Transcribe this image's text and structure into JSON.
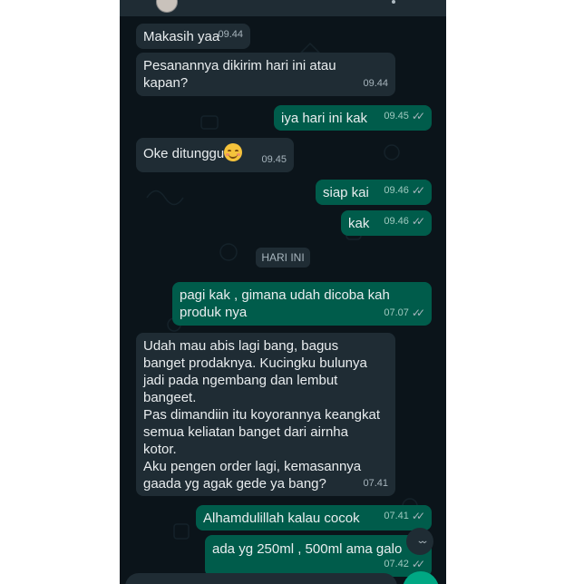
{
  "chat": {
    "messages": [
      {
        "dir": "in",
        "text": "Makasih yaa",
        "time": "09.44"
      },
      {
        "dir": "in",
        "text": "Pesanannya dikirim hari ini atau kapan?",
        "time": "09.44"
      },
      {
        "dir": "out",
        "text": "iya hari ini kak",
        "time": "09.45",
        "status": "read"
      },
      {
        "dir": "in",
        "text": "Oke ditunggu",
        "emoji": "smiling-face-icon",
        "time": "09.45"
      },
      {
        "dir": "out",
        "text": "siap kai",
        "time": "09.46",
        "status": "read"
      },
      {
        "dir": "out",
        "text": "kak",
        "time": "09.46",
        "status": "read"
      },
      {
        "dir": "out",
        "text": "pagi kak , gimana udah dicoba kah produk nya",
        "time": "07.07",
        "status": "read"
      },
      {
        "dir": "in",
        "text": "Udah mau abis lagi bang, bagus banget prodaknya. Kucingku bulunya jadi pada ngembang dan lembut bangeet.\nPas dimandiin itu koyorannya keangkat semua keliatan banget dari airnha kotor.\nAku pengen order lagi, kemasannya gaada yg agak gede ya bang?",
        "time": "07.41"
      },
      {
        "dir": "out",
        "text": "Alhamdulillah kalau cocok",
        "time": "07.41",
        "status": "read"
      },
      {
        "dir": "out",
        "text": "ada yg 250ml , 500ml ama galo",
        "time": "07.42",
        "status": "read"
      }
    ],
    "day_divider": "HARI INI",
    "read_ticks": "✓✓",
    "scroll_down_glyph": "⌄⌄"
  },
  "colors": {
    "chat_background": "#0b141a",
    "incoming_bubble": "#1f2c34",
    "outgoing_bubble": "#005c4b",
    "accent": "#00a884"
  }
}
